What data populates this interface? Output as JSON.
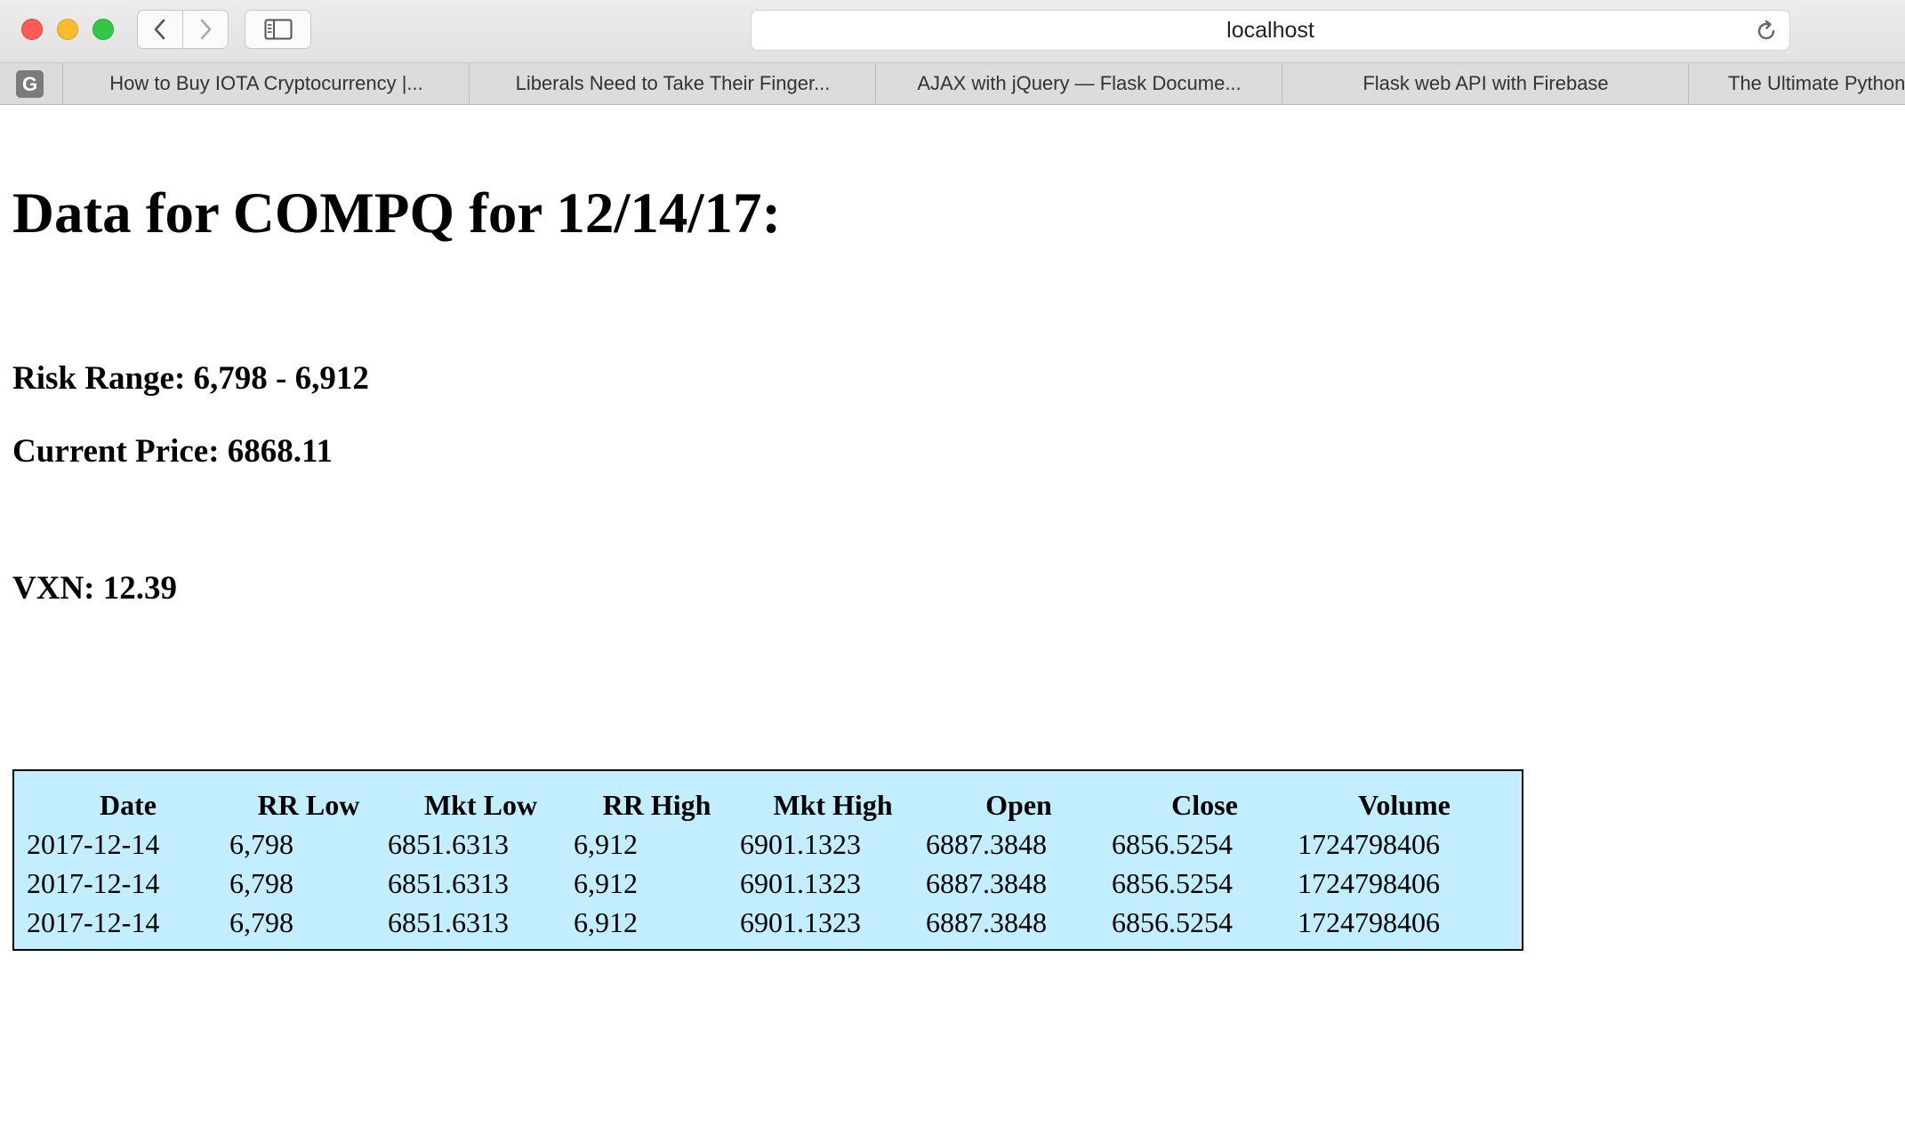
{
  "browser": {
    "address": "localhost",
    "favicon_letter": "G",
    "tabs": [
      "How to Buy IOTA Cryptocurrency |...",
      "Liberals Need to Take Their Finger...",
      "AJAX with jQuery — Flask Docume...",
      "Flask web API with Firebase",
      "The Ultimate Python"
    ]
  },
  "page": {
    "title": "Data for COMPQ for 12/14/17:",
    "risk_range": "Risk Range: 6,798 - 6,912",
    "current_price": "Current Price: 6868.11",
    "vxn": "VXN: 12.39"
  },
  "table": {
    "background": "#c2eeff",
    "headers": [
      "Date",
      "RR Low",
      "Mkt Low",
      "RR High",
      "Mkt High",
      "Open",
      "Close",
      "Volume"
    ],
    "rows": [
      [
        "2017-12-14",
        "6,798",
        "6851.6313",
        "6,912",
        "6901.1323",
        "6887.3848",
        "6856.5254",
        "1724798406"
      ],
      [
        "2017-12-14",
        "6,798",
        "6851.6313",
        "6,912",
        "6901.1323",
        "6887.3848",
        "6856.5254",
        "1724798406"
      ],
      [
        "2017-12-14",
        "6,798",
        "6851.6313",
        "6,912",
        "6901.1323",
        "6887.3848",
        "6856.5254",
        "1724798406"
      ]
    ]
  }
}
